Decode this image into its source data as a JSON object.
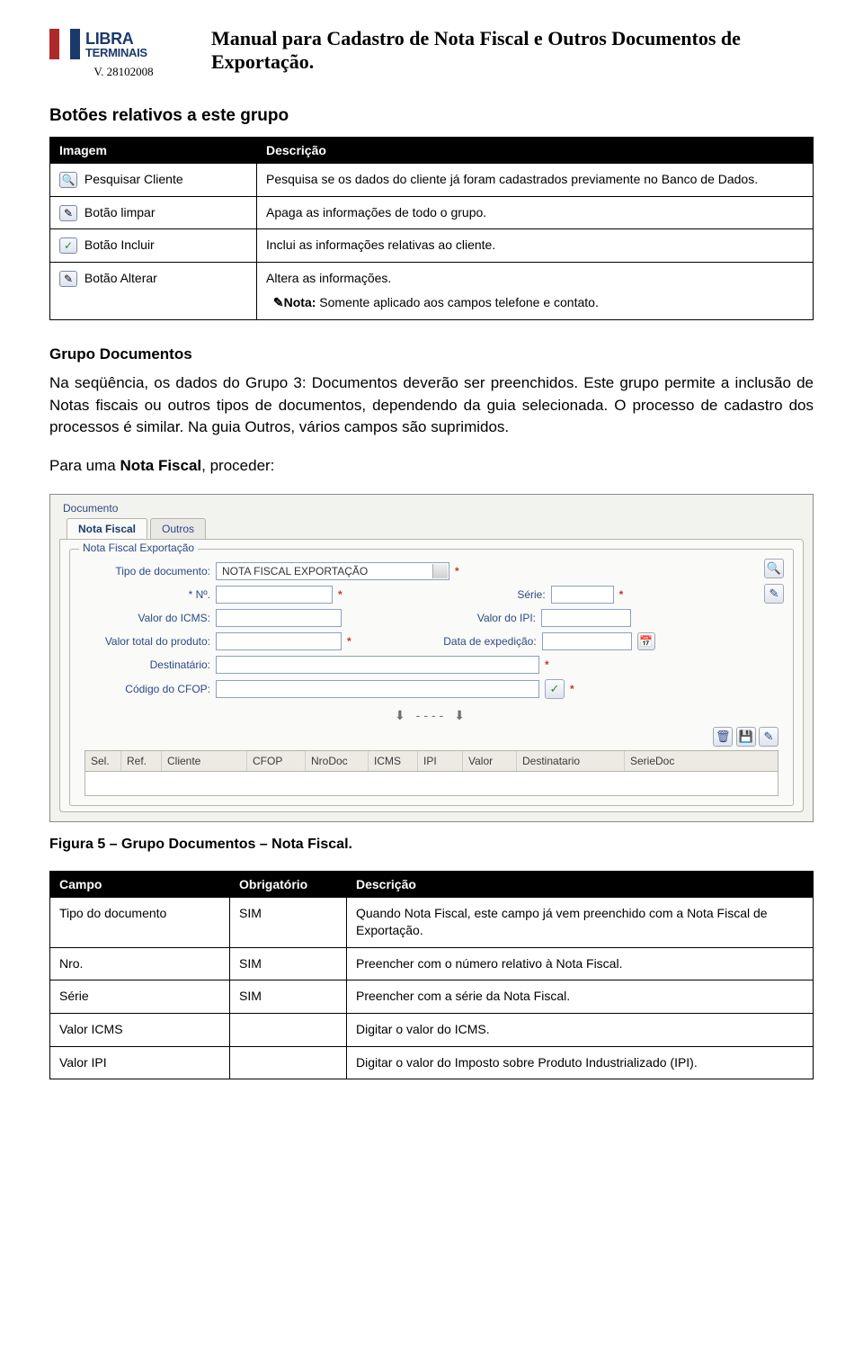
{
  "header": {
    "logo_line1": "LIBRA",
    "logo_line2": "TERMINAIS",
    "version": "V. 28102008",
    "title": "Manual para Cadastro de Nota Fiscal e Outros Documentos de Exportação."
  },
  "section1_title": "Botões relativos a este grupo",
  "table1": {
    "headers": [
      "Imagem",
      "Descrição"
    ],
    "rows": [
      {
        "img_label": "Pesquisar Cliente",
        "icon_glyph": "🔍",
        "desc": "Pesquisa se os dados do cliente já foram cadastrados previamente no Banco de Dados."
      },
      {
        "img_label": "Botão limpar",
        "icon_glyph": "✎",
        "desc": "Apaga as informações de todo o grupo."
      },
      {
        "img_label": "Botão Incluir",
        "icon_glyph": "✓",
        "desc": "Inclui as informações relativas ao cliente."
      },
      {
        "img_label": "Botão Alterar",
        "icon_glyph": "✎",
        "desc": "Altera as informações.",
        "note_prefix": "✎Nota:",
        "note": " Somente aplicado aos campos telefone e contato."
      }
    ]
  },
  "section2_title": "Grupo Documentos",
  "paragraph1": "Na seqüência, os dados do Grupo 3: Documentos deverão ser preenchidos. Este grupo permite a inclusão de Notas fiscais ou outros tipos de documentos, dependendo da guia selecionada. O processo de cadastro dos processos é similar. Na guia Outros, vários campos são suprimidos.",
  "paragraph2_prefix": "Para uma ",
  "paragraph2_bold": "Nota Fiscal",
  "paragraph2_suffix": ", proceder:",
  "screenshot": {
    "outer_legend": "Documento",
    "tab_active": "Nota Fiscal",
    "tab_inactive": "Outros",
    "inner_legend": "Nota Fiscal Exportação",
    "labels": {
      "tipo": "Tipo de documento:",
      "tipo_value": "NOTA FISCAL EXPORTAÇÃO",
      "no": "* Nº.",
      "serie": "Série:",
      "icms": "Valor do ICMS:",
      "ipi": "Valor do IPI:",
      "valor_total": "Valor total do produto:",
      "data_exped": "Data de expedição:",
      "destinatario": "Destinatário:",
      "cfop": "Código do CFOP:"
    },
    "grid_headers": [
      "Sel.",
      "Ref.",
      "Cliente",
      "CFOP",
      "NroDoc",
      "ICMS",
      "IPI",
      "Valor",
      "Destinatario",
      "SerieDoc"
    ]
  },
  "figure_caption": "Figura 5 – Grupo Documentos – Nota Fiscal.",
  "table2": {
    "headers": [
      "Campo",
      "Obrigatório",
      "Descrição"
    ],
    "rows": [
      {
        "campo": "Tipo do documento",
        "obr": "SIM",
        "desc": "Quando Nota Fiscal, este campo já vem preenchido com a Nota Fiscal de Exportação."
      },
      {
        "campo": "Nro.",
        "obr": "SIM",
        "desc": "Preencher com o número relativo à Nota Fiscal."
      },
      {
        "campo": "Série",
        "obr": "SIM",
        "desc": "Preencher com a série da Nota Fiscal."
      },
      {
        "campo": "Valor ICMS",
        "obr": "",
        "desc": "Digitar o valor do ICMS."
      },
      {
        "campo": "Valor IPI",
        "obr": "",
        "desc": "Digitar o valor do Imposto sobre Produto Industrializado (IPI)."
      }
    ]
  }
}
